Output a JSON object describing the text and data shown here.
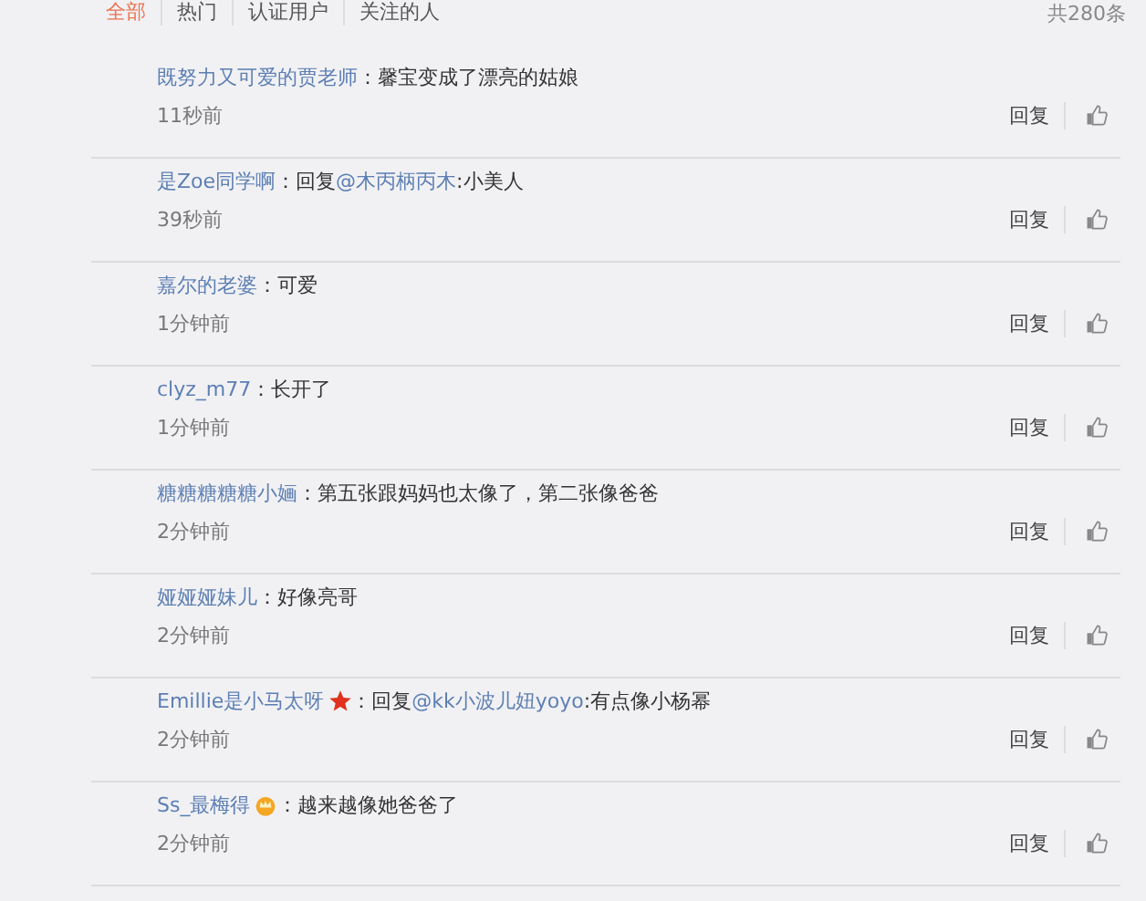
{
  "tabs": [
    {
      "label": "全部",
      "selected": true
    },
    {
      "label": "热门",
      "selected": false
    },
    {
      "label": "认证用户",
      "selected": false
    },
    {
      "label": "关注的人",
      "selected": false
    }
  ],
  "total": "共280条",
  "comments": [
    {
      "user": "既努力又可爱的贾老师",
      "separator": "：",
      "text": "馨宝变成了漂亮的姑娘",
      "time": "11秒前",
      "reply": "回复"
    },
    {
      "user": "是Zoe同学啊",
      "separator": "：",
      "prefix": "回复",
      "mention": "@木丙柄丙木",
      "text": ":小美人",
      "time": "39秒前",
      "reply": "回复"
    },
    {
      "user": "嘉尔的老婆",
      "separator": "：",
      "text": "可爱",
      "time": "1分钟前",
      "reply": "回复"
    },
    {
      "user": "clyz_m77",
      "separator": "：",
      "text": "长开了",
      "time": "1分钟前",
      "reply": "回复"
    },
    {
      "user": "糖糖糖糖糖小婳",
      "separator": "：",
      "text": "第五张跟妈妈也太像了，第二张像爸爸",
      "time": "2分钟前",
      "reply": "回复"
    },
    {
      "user": "娅娅娅妹儿",
      "separator": "：",
      "text": "好像亮哥",
      "time": "2分钟前",
      "reply": "回复"
    },
    {
      "user": "Emillie是小马太呀",
      "badge": {
        "kind": "star"
      },
      "separator": "：",
      "prefix": "回复",
      "mention": "@kk小波儿妞yoyo",
      "text": ":有点像小杨幂",
      "time": "2分钟前",
      "reply": "回复"
    },
    {
      "user": "Ss_最梅得",
      "badge": {
        "kind": "crown"
      },
      "separator": "：",
      "text": "越来越像她爸爸了",
      "time": "2分钟前",
      "reply": "回复"
    }
  ]
}
